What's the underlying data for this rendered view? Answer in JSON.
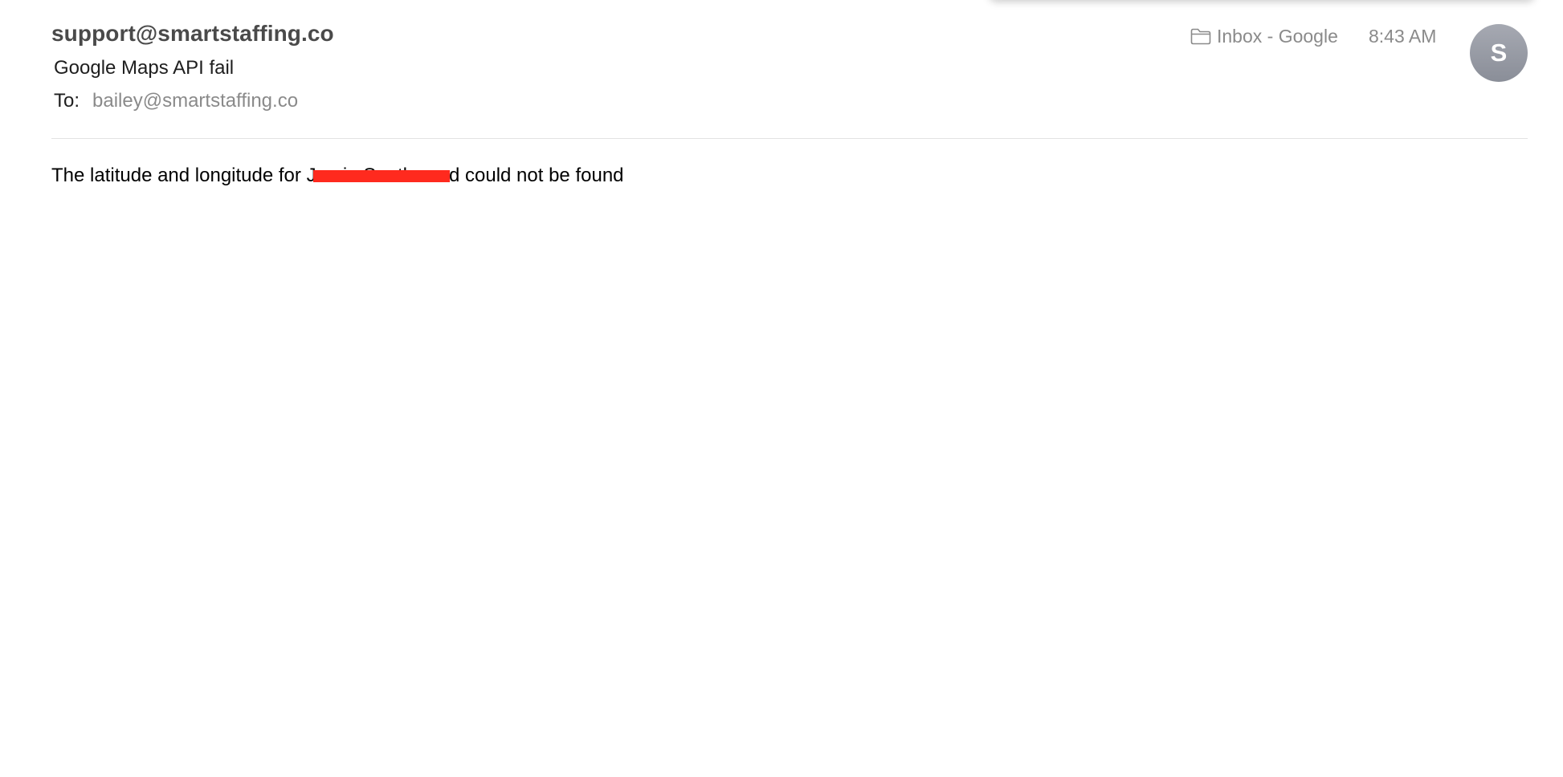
{
  "email": {
    "sender": "support@smartstaffing.co",
    "subject": "Google Maps API fail",
    "to_label": "To:",
    "to_value": "bailey@smartstaffing.co",
    "mailbox": "Inbox - Google",
    "time": "8:43 AM",
    "avatar_initial": "S",
    "avatar_color": "#9a9ea8"
  },
  "body": {
    "before": "The latitude and longitude for ",
    "redacted_name": "Jamie Southwood",
    "after": " could not be found",
    "redaction_color": "#ff2a1e"
  },
  "icons": {
    "mailbox_icon": "folder-icon"
  }
}
